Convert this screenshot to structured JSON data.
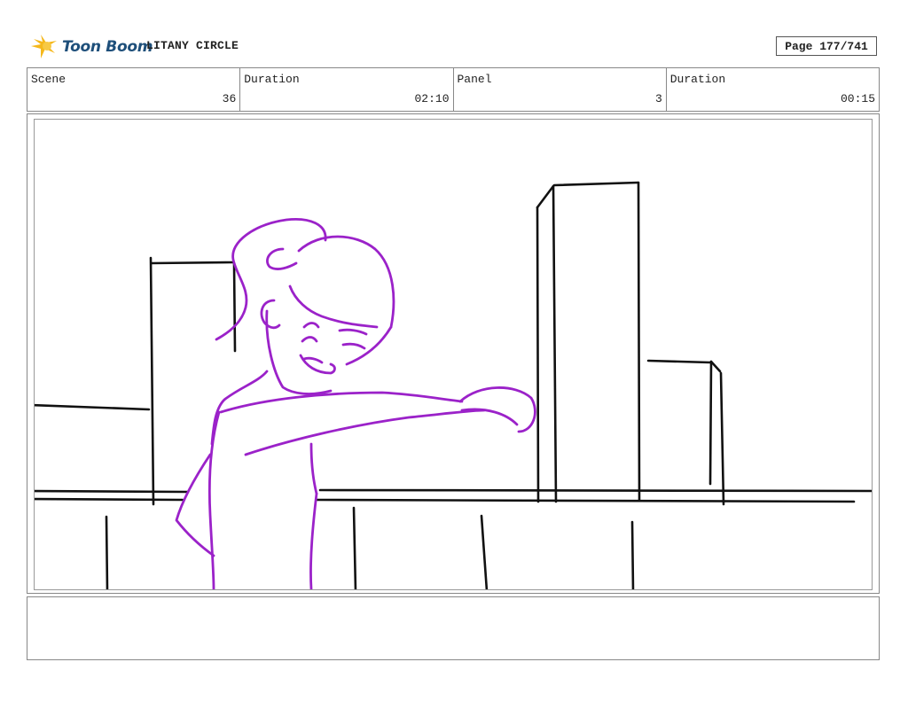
{
  "header": {
    "logo_text": "Toon Boom",
    "project_title": "LITANY CIRCLE",
    "page_label": "Page 177/741"
  },
  "info": {
    "scene_label": "Scene",
    "scene_value": "36",
    "scene_duration_label": "Duration",
    "scene_duration_value": "02:10",
    "panel_label": "Panel",
    "panel_value": "3",
    "panel_duration_label": "Duration",
    "panel_duration_value": "00:15"
  },
  "colors": {
    "logo_star": "#f5b81c",
    "logo_text": "#1e4f7a",
    "sketch_character": "#9b22c9",
    "sketch_background": "#111111"
  },
  "icons": {
    "logo": "toon-boom-star-icon"
  },
  "notes": ""
}
